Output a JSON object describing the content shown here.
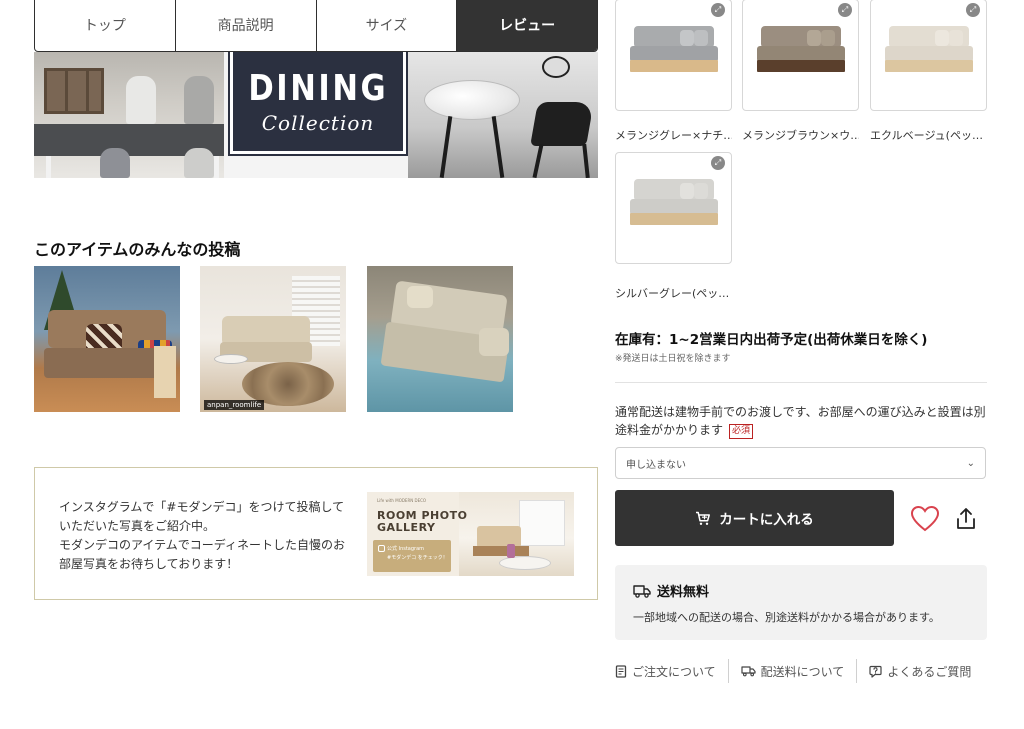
{
  "tabs": [
    {
      "label": "トップ",
      "active": false
    },
    {
      "label": "商品説明",
      "active": false
    },
    {
      "label": "サイズ",
      "active": false
    },
    {
      "label": "レビュー",
      "active": true
    }
  ],
  "hero": {
    "title": "DINING",
    "subtitle": "Collection"
  },
  "posts": {
    "title": "このアイテムのみんなの投稿",
    "items": [
      {
        "tag": ""
      },
      {
        "tag": "anpan_roomlife"
      },
      {
        "tag": ""
      }
    ]
  },
  "promo": {
    "lines": [
      "インスタグラムで「#モダンデコ」をつけて投稿して",
      "いただいた写真をご紹介中。",
      "モダンデコのアイテムでコーディネートした自慢のお",
      "部屋写真をお待ちしております！"
    ],
    "banner": {
      "small": "Life with MODERN DECO",
      "title_line1": "ROOM PHOTO",
      "title_line2": "GALLERY",
      "chip_line1": "公式 Instagram",
      "chip_line2": "#モダンデコ をチェック！"
    }
  },
  "colors": {
    "items": [
      {
        "label": "メランジグレー×ナチ…",
        "fabric": "#a9abad",
        "base": "#d9b98a"
      },
      {
        "label": "メランジブラウン×ウ…",
        "fabric": "#9b8e80",
        "base": "#5a3f2c"
      },
      {
        "label": "エクルベージュ(ペッ…",
        "fabric": "#e3ddd2",
        "base": "#dcc6a0"
      },
      {
        "label": "シルバーグレー(ペッ…",
        "fabric": "#d5d4d0",
        "base": "#d6bc92"
      }
    ],
    "zoom_icon": "expand-icon"
  },
  "stock": {
    "status": "在庫有：1~2営業日内出荷予定(出荷休業日を除く)",
    "note": "※発送日は土日祝を除きます"
  },
  "delivery": {
    "text": "通常配送は建物手前でのお渡しです、お部屋への運び込みと設置は別途料金がかかります",
    "required": "必須",
    "select_value": "申し込まない"
  },
  "cart": {
    "label": "カートに入れる",
    "icon": "cart-icon"
  },
  "shipping": {
    "title": "送料無料",
    "desc": "一部地域への配送の場合、別途送料がかかる場合があります。"
  },
  "links": [
    {
      "label": "ご注文について",
      "icon": "document-icon"
    },
    {
      "label": "配送料について",
      "icon": "truck-icon"
    },
    {
      "label": "よくあるご質問",
      "icon": "question-icon"
    }
  ],
  "accent": {
    "dark": "#333333",
    "heart": "#d9434e",
    "required": "#bb2222"
  }
}
